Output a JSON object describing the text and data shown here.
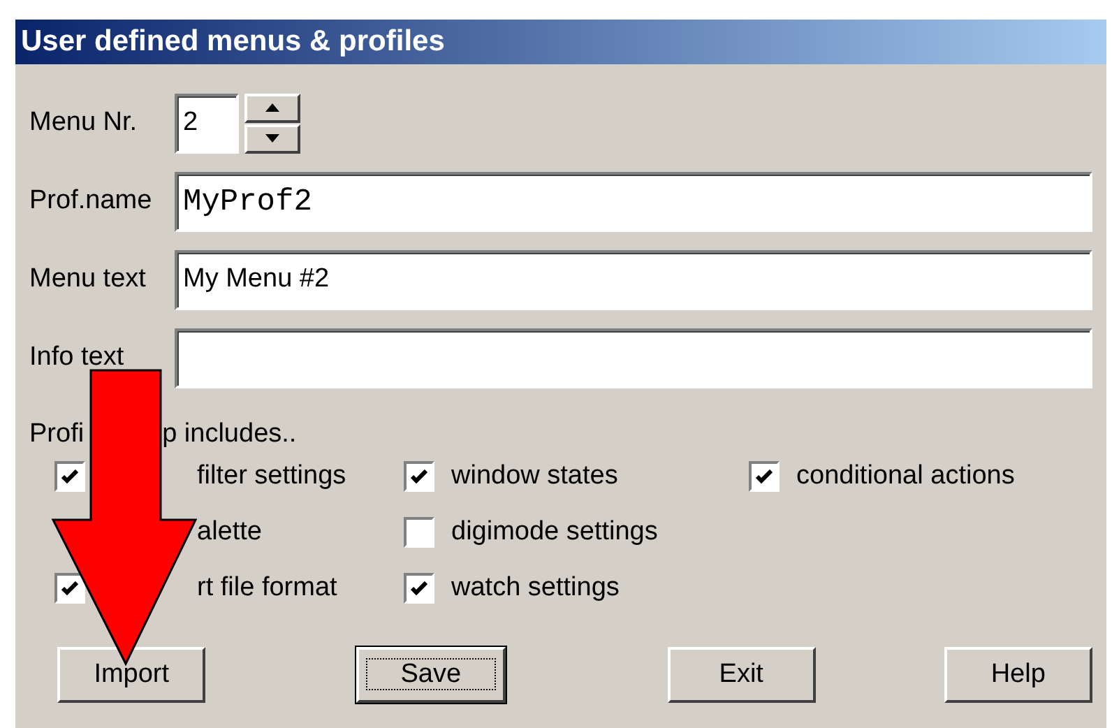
{
  "window": {
    "title": "User defined menus & profiles"
  },
  "menu_nr": {
    "label": "Menu Nr.",
    "value": "2"
  },
  "fields": [
    {
      "label": "Prof.name",
      "value": "MyProf2",
      "kind": "mono"
    },
    {
      "label": "Menu text",
      "value": "My Menu #2",
      "kind": "plain"
    },
    {
      "label": "Info text",
      "kind": "plain"
    }
  ],
  "setup_label_parts": [
    "Profi",
    "p  includes.."
  ],
  "option_columns": [
    [
      {
        "label": "filter settings",
        "checked": true
      },
      {
        "label": "alette"
      },
      {
        "label": "rt file format",
        "checked": true
      }
    ],
    [
      {
        "label": "window states",
        "checked": true
      },
      {
        "label": "digimode settings",
        "checked": false
      },
      {
        "label": "watch settings",
        "checked": true
      }
    ],
    [
      {
        "label": "conditional actions",
        "checked": true
      }
    ]
  ],
  "buttons": [
    {
      "label": "Import",
      "default": false
    },
    {
      "label": "Save",
      "default": true
    },
    {
      "label": "Exit",
      "default": false
    },
    {
      "label": "Help",
      "default": false
    }
  ]
}
